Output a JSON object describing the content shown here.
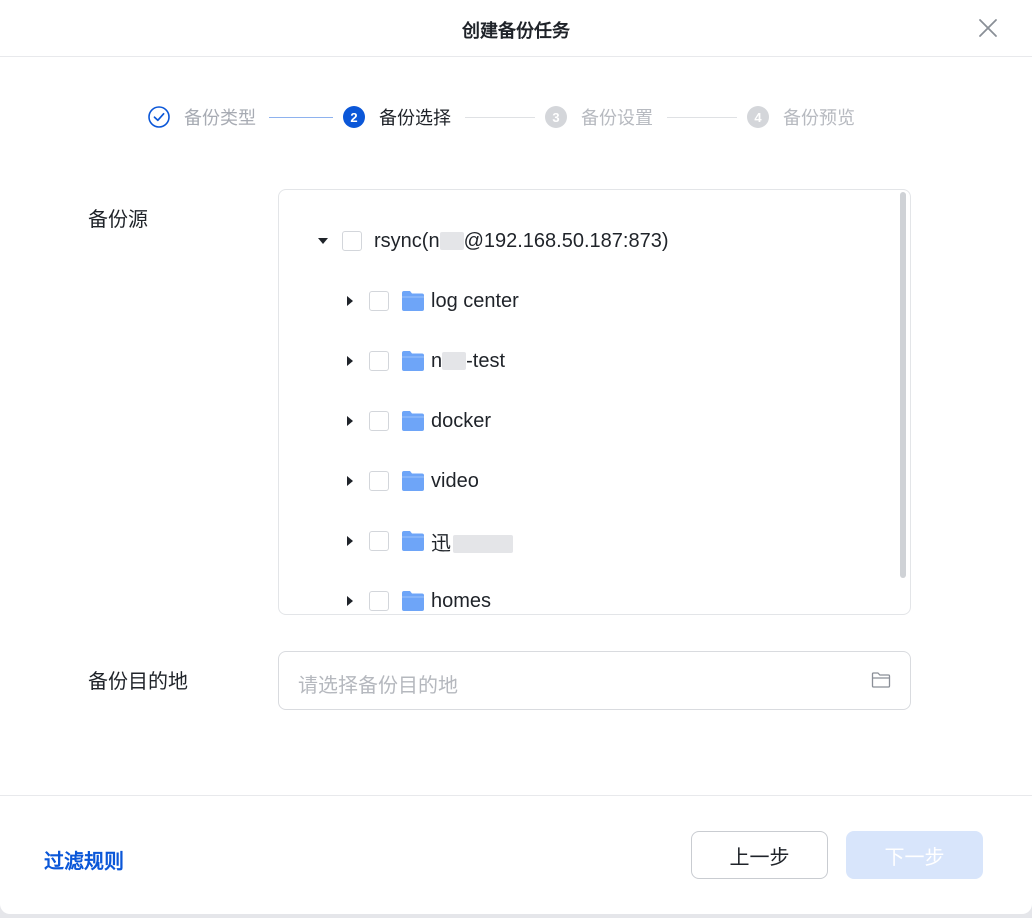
{
  "dialog": {
    "title": "创建备份任务"
  },
  "steps": [
    {
      "number": "1",
      "label": "备份类型",
      "state": "done"
    },
    {
      "number": "2",
      "label": "备份选择",
      "state": "active"
    },
    {
      "number": "3",
      "label": "备份设置",
      "state": "pending"
    },
    {
      "number": "4",
      "label": "备份预览",
      "state": "pending"
    }
  ],
  "form": {
    "source_label": "备份源",
    "destination_label": "备份目的地",
    "destination_placeholder": "请选择备份目的地"
  },
  "tree": {
    "root": {
      "prefix": "rsync(n",
      "suffix": "@192.168.50.187:873)",
      "expanded": true
    },
    "children": [
      {
        "label": "log center"
      },
      {
        "prefix": "n",
        "suffix": "-test"
      },
      {
        "label": "docker"
      },
      {
        "label": "video"
      },
      {
        "prefix": "迅"
      },
      {
        "label": "homes"
      }
    ]
  },
  "footer": {
    "filter_rules": "过滤规则",
    "prev_label": "上一步",
    "next_label": "下一步"
  },
  "colors": {
    "accent": "#0b57d8",
    "folder": "#6ea5f8",
    "disabled_button": "#d8e5fb"
  }
}
